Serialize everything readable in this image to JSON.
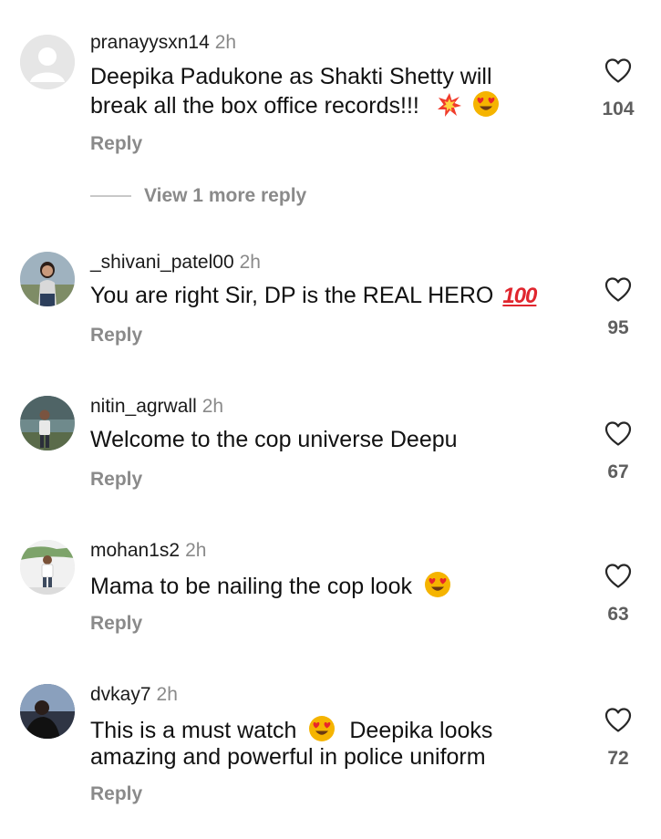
{
  "comments": [
    {
      "username": "pranayysxn14",
      "time": "2h",
      "text_line1": "Deepika Padukone as Shakti Shetty will",
      "text_line2": "break all the box office records!!!",
      "emojis": [
        "collision-emoji",
        "heart-eyes-emoji"
      ],
      "reply": "Reply",
      "likes": "104",
      "avatar": "default-avatar"
    },
    {
      "username": "_shivani_patel00",
      "time": "2h",
      "text": "You are right Sir, DP is the REAL HERO",
      "emoji_text": "100",
      "reply": "Reply",
      "likes": "95",
      "avatar": "user-photo"
    },
    {
      "username": "nitin_agrwall",
      "time": "2h",
      "text": "Welcome to the cop universe Deepu",
      "reply": "Reply",
      "likes": "67",
      "avatar": "user-photo"
    },
    {
      "username": "mohan1s2",
      "time": "2h",
      "text": "Mama to be nailing the cop look",
      "emojis": [
        "heart-eyes-emoji"
      ],
      "reply": "Reply",
      "likes": "63",
      "avatar": "user-photo"
    },
    {
      "username": "dvkay7",
      "time": "2h",
      "text_part1": "This is a must watch",
      "text_part2": "Deepika looks",
      "text_line2": "amazing and powerful in police uniform",
      "emojis": [
        "heart-eyes-emoji"
      ],
      "reply": "Reply",
      "likes": "72",
      "avatar": "user-photo"
    }
  ],
  "view_more_replies": "View 1 more reply",
  "icons": {
    "like": "heart-outline-icon"
  },
  "colors": {
    "secondary_text": "#8a8a8a",
    "hundred_emoji": "#e0262e",
    "heart_eyes": "#f5b400"
  }
}
